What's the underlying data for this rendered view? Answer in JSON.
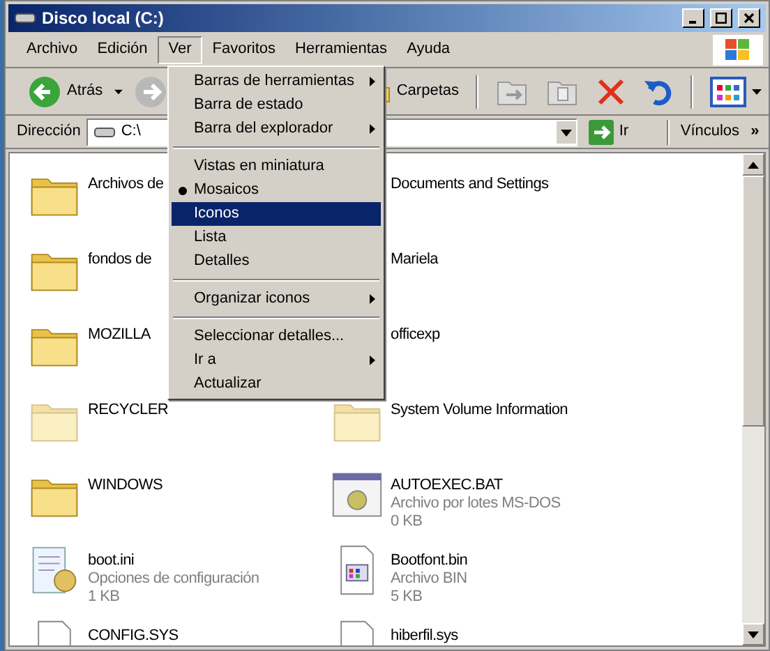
{
  "window": {
    "title": "Disco local (C:)"
  },
  "menu_bar": [
    {
      "label": "Archivo",
      "selected": false
    },
    {
      "label": "Edición",
      "selected": false
    },
    {
      "label": "Ver",
      "selected": true
    },
    {
      "label": "Favoritos",
      "selected": false
    },
    {
      "label": "Herramientas",
      "selected": false
    },
    {
      "label": "Ayuda",
      "selected": false
    }
  ],
  "toolbar": {
    "back": {
      "label": "Atrás",
      "disabled": false
    },
    "forward": {
      "disabled": true
    },
    "folders": {
      "label": "Carpetas"
    }
  },
  "address_bar": {
    "label": "Dirección",
    "value": "C:\\",
    "go": "Ir",
    "links": "Vínculos",
    "more": "»"
  },
  "view_menu": [
    {
      "kind": "item",
      "label": "Barras de herramientas",
      "submenu": true,
      "selected": false,
      "highlighted": false
    },
    {
      "kind": "item",
      "label": "Barra de estado",
      "submenu": false,
      "selected": false,
      "highlighted": false
    },
    {
      "kind": "item",
      "label": "Barra del explorador",
      "submenu": true,
      "selected": false,
      "highlighted": false
    },
    {
      "kind": "separator"
    },
    {
      "kind": "item",
      "label": "Vistas en miniatura",
      "submenu": false,
      "selected": false,
      "highlighted": false
    },
    {
      "kind": "item",
      "label": "Mosaicos",
      "submenu": false,
      "selected": true,
      "highlighted": false
    },
    {
      "kind": "item",
      "label": "Iconos",
      "submenu": false,
      "selected": false,
      "highlighted": true
    },
    {
      "kind": "item",
      "label": "Lista",
      "submenu": false,
      "selected": false,
      "highlighted": false
    },
    {
      "kind": "item",
      "label": "Detalles",
      "submenu": false,
      "selected": false,
      "highlighted": false
    },
    {
      "kind": "separator"
    },
    {
      "kind": "item",
      "label": "Organizar iconos",
      "submenu": true,
      "selected": false,
      "highlighted": false
    },
    {
      "kind": "separator"
    },
    {
      "kind": "item",
      "label": "Seleccionar detalles...",
      "submenu": false,
      "selected": false,
      "highlighted": false
    },
    {
      "kind": "item",
      "label": "Ir a",
      "submenu": true,
      "selected": false,
      "highlighted": false
    },
    {
      "kind": "item",
      "label": "Actualizar",
      "submenu": false,
      "selected": false,
      "highlighted": false
    }
  ],
  "files": [
    {
      "kind": "folder",
      "name": "Archivos de",
      "hidden": false
    },
    {
      "kind": "folder",
      "name": "Documents and Settings"
    },
    {
      "kind": "folder",
      "name": "fondos de",
      "hidden": false
    },
    {
      "kind": "folder",
      "name": "Mariela"
    },
    {
      "kind": "folder",
      "name": "MOZILLA",
      "hidden": false
    },
    {
      "kind": "folder",
      "name": "officexp"
    },
    {
      "kind": "folder",
      "name": "RECYCLER",
      "hidden": true
    },
    {
      "kind": "folder",
      "name": "System Volume Information",
      "hidden": true
    },
    {
      "kind": "folder",
      "name": "WINDOWS",
      "hidden": false
    },
    {
      "kind": "batch",
      "name": "AUTOEXEC.BAT",
      "type": "Archivo por lotes MS-DOS",
      "size": "0 KB",
      "hidden": false
    },
    {
      "kind": "settings",
      "name": "boot.ini",
      "type": "Opciones de configuración",
      "size": "1 KB",
      "hidden": false
    },
    {
      "kind": "binary",
      "name": "Bootfont.bin",
      "type": "Archivo BIN",
      "size": "5 KB",
      "hidden": false
    },
    {
      "kind": "document",
      "name": "CONFIG.SYS",
      "hidden": false
    },
    {
      "kind": "document",
      "name": "hiberfil.sys",
      "hidden": false
    }
  ]
}
